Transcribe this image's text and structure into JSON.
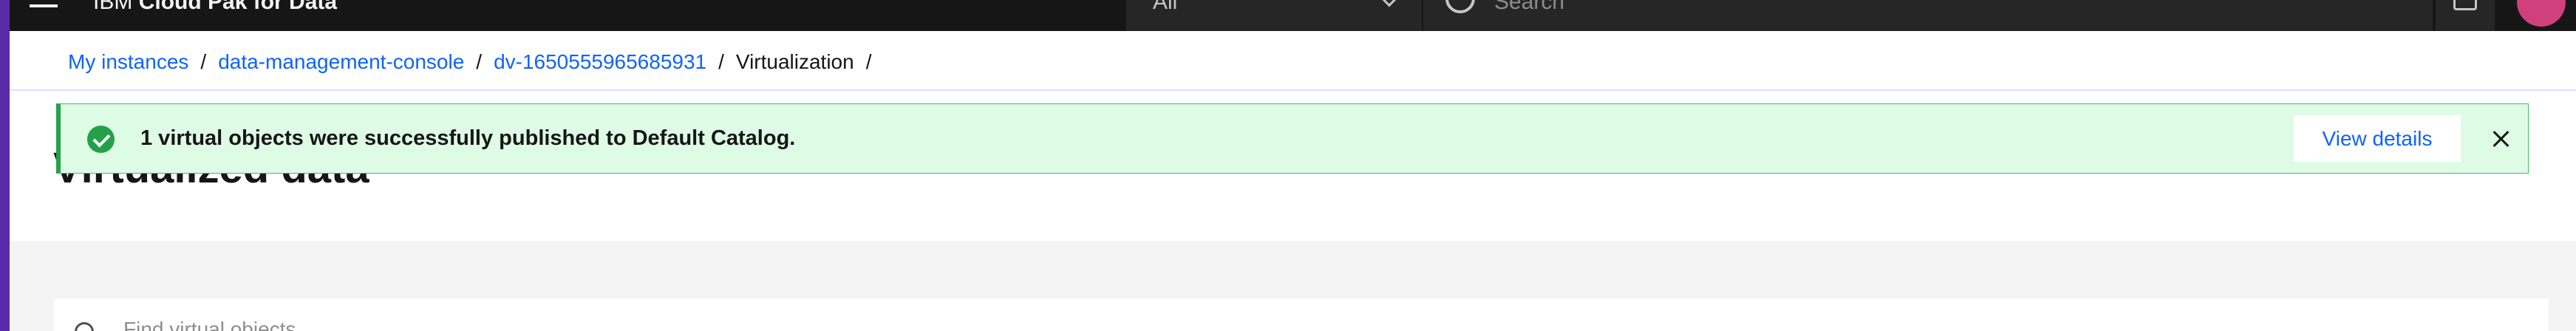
{
  "header": {
    "brand_prefix": "IBM",
    "brand_name": "Cloud Pak for Data",
    "scope_value": "All",
    "search_placeholder": "Search"
  },
  "breadcrumb": {
    "items": [
      "My instances",
      "data-management-console",
      "dv-1650555965685931",
      "Virtualization"
    ],
    "separator": "/"
  },
  "page": {
    "title": "Virtualized data"
  },
  "notification": {
    "message": "1 virtual objects were successfully published to Default Catalog.",
    "action_label": "View details",
    "status": "success"
  },
  "filter": {
    "placeholder": "Find virtual objects"
  },
  "colors": {
    "header_bg": "#161616",
    "accent_strip": "#5a2ba8",
    "link": "#0f62fe",
    "success_bg": "#defbe6",
    "success_icon": "#24a148",
    "avatar": "#d0407d"
  },
  "icons": [
    "menu-icon",
    "chevron-down-icon",
    "search-icon",
    "notification-icon",
    "checkmark-icon",
    "close-icon"
  ]
}
